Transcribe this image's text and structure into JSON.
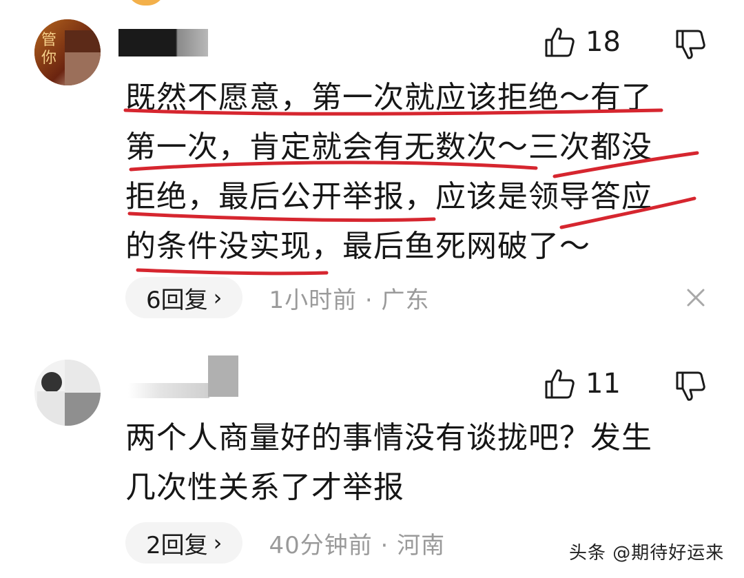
{
  "comments": [
    {
      "likes": "18",
      "text_lines": [
        "既然不愿意，第一次就应该拒绝～有了",
        "第一次，肯定就会有无数次～三次都没",
        "拒绝，最后公开举报，应该是领导答应",
        "的条件没实现，最后鱼死网破了～"
      ],
      "reply_label": "6回复",
      "time_location": "1小时前 · 广东",
      "avatar_text": "管你"
    },
    {
      "likes": "11",
      "text_lines": [
        "两个人商量好的事情没有谈拢吧？发生",
        "几次性关系了才举报"
      ],
      "reply_label": "2回复",
      "time_location": "40分钟前 · 河南"
    }
  ],
  "icons": {
    "like": "thumbs-up-icon",
    "dislike": "thumbs-down-icon",
    "close": "close-icon",
    "chevron": "chevron-right-icon"
  },
  "colors": {
    "annotation_red": "#d6262f",
    "pill_bg": "#f4f4f4",
    "meta_gray": "#9a9a9a"
  },
  "watermark": "头条 @期待好运来"
}
